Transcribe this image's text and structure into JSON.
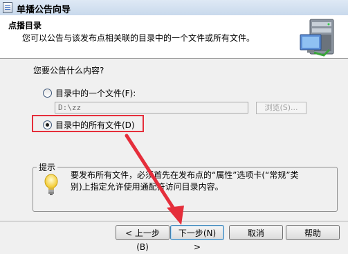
{
  "window": {
    "title": "单播公告向导"
  },
  "header": {
    "title": "点播目录",
    "subtitle": "您可以公告与该发布点相关联的目录中的一个文件或所有文件。",
    "icon": "server-computer-icon"
  },
  "body": {
    "question": "您要公告什么内容?",
    "options": [
      {
        "label": "目录中的一个文件(F):",
        "selected": false
      },
      {
        "label": "目录中的所有文件(D)",
        "selected": true
      }
    ],
    "file_path": "D:\\zz",
    "browse_label": "浏览(S)..."
  },
  "hint": {
    "legend": "提示",
    "icon": "lightbulb-icon",
    "text": "要发布所有文件，必须首先在发布点的“属性”选项卡(“常规”类别)上指定允许使用通配符访问目录内容。"
  },
  "buttons": {
    "back": "< 上一步(B)",
    "next": "下一步(N) >",
    "cancel": "取消",
    "help": "帮助"
  },
  "annotation": {
    "color": "#e52e3b"
  }
}
